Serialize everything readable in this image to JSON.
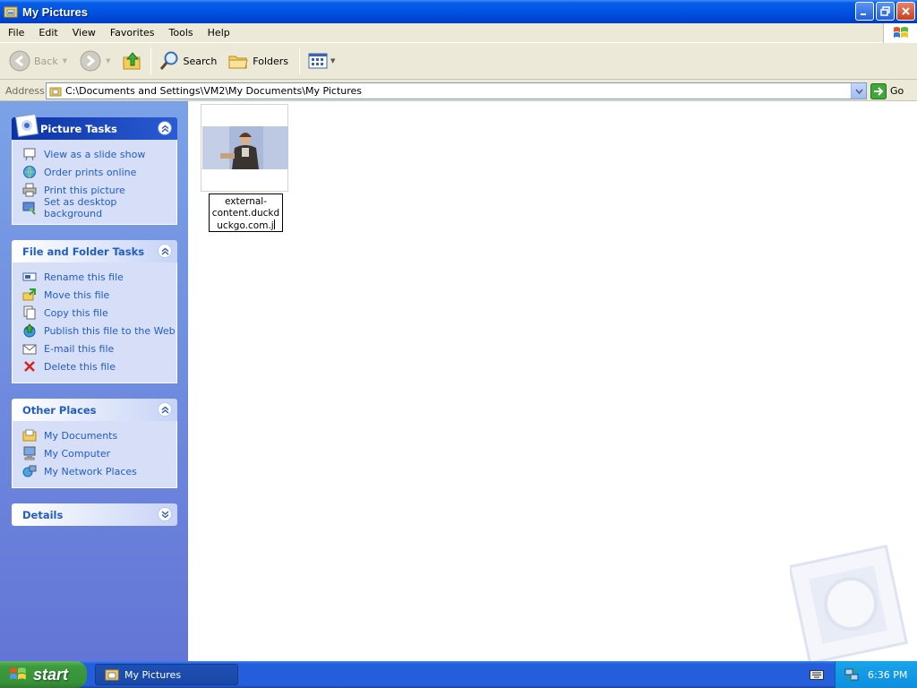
{
  "window": {
    "title": "My Pictures"
  },
  "menu": [
    "File",
    "Edit",
    "View",
    "Favorites",
    "Tools",
    "Help"
  ],
  "toolbar": {
    "back": "Back",
    "search": "Search",
    "folders": "Folders"
  },
  "address": {
    "label": "Address",
    "path": "C:\\Documents and Settings\\VM2\\My Documents\\My Pictures",
    "go": "Go"
  },
  "panels": {
    "picture_tasks": {
      "title": "Picture Tasks",
      "items": [
        "View as a slide show",
        "Order prints online",
        "Print this picture",
        "Set as desktop background"
      ]
    },
    "file_folder_tasks": {
      "title": "File and Folder Tasks",
      "items": [
        "Rename this file",
        "Move this file",
        "Copy this file",
        "Publish this file to the Web",
        "E-mail this file",
        "Delete this file"
      ]
    },
    "other_places": {
      "title": "Other Places",
      "items": [
        "My Documents",
        "My Computer",
        "My Network Places"
      ]
    },
    "details": {
      "title": "Details"
    }
  },
  "file": {
    "rename_lines": [
      "external-",
      "content.duckd",
      "uckgo.com.j"
    ]
  },
  "taskbar": {
    "start": "start",
    "window": "My Pictures",
    "clock": "6:36 PM"
  },
  "colors": {
    "titlebar": "#0054e3",
    "task_link": "#215dc6",
    "panel_body": "#d6dff7",
    "start_green": "#3c9a3c"
  }
}
